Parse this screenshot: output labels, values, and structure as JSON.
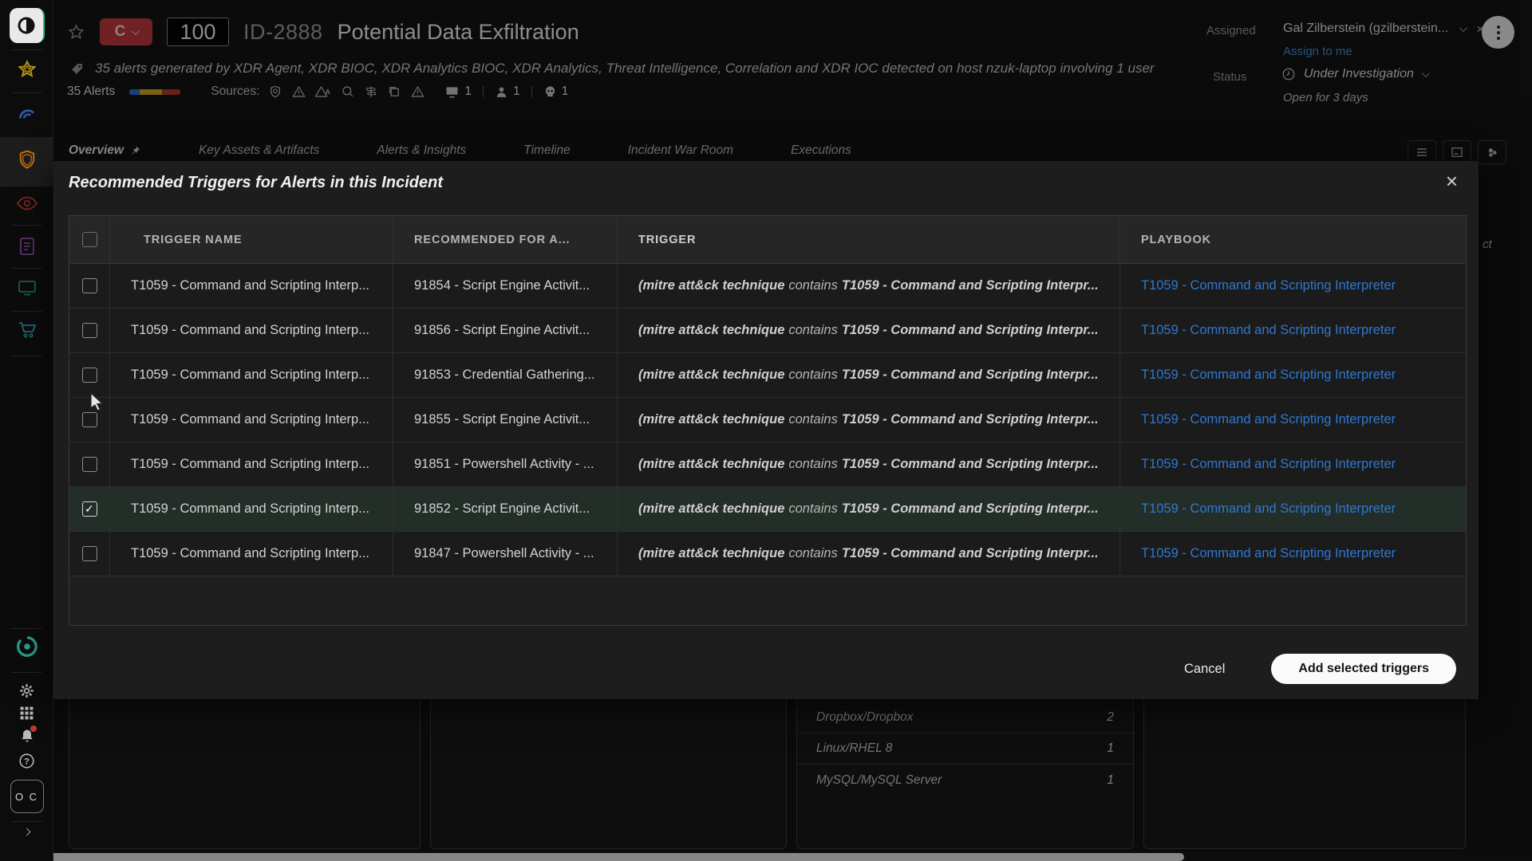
{
  "colors": {
    "severity_red": "#c13a3f",
    "link_blue": "#478fd9",
    "playbook_link": "#2e78d2",
    "selected_row": "#242e28",
    "alert_bar_blue": "#2f6fd6",
    "alert_bar_yellow": "#d1a722",
    "alert_bar_red": "#b03a2e"
  },
  "sidebar": {
    "avatar_initials": "O C",
    "icons_top": [
      "cortex-logo",
      "star",
      "radar",
      "shield-active",
      "eye",
      "report",
      "monitor",
      "cart"
    ],
    "icons_bottom": [
      "ring-logo",
      "gear",
      "apps-grid",
      "bell-notification",
      "help",
      "avatar",
      "expand-chevron"
    ]
  },
  "header": {
    "severity": "C",
    "score": "100",
    "incident_id": "ID-2888",
    "title": "Potential Data Exfiltration",
    "description": "35 alerts generated by XDR Agent, XDR BIOC, XDR Analytics BIOC, XDR Analytics, Threat Intelligence, Correlation and XDR IOC detected on host nzuk-laptop involving 1 user",
    "alerts_count": "35 Alerts",
    "sources_label": "Sources:",
    "source_icons": [
      "shield",
      "alert-triangle",
      "alert-triangle-a",
      "search-glass",
      "signpost",
      "copy",
      "alert-triangle-2"
    ],
    "endpoint_count": "1",
    "user_count": "1",
    "threat_count": "1",
    "assigned_label": "Assigned",
    "assignee": "Gal Zilberstein (gzilberstein...",
    "assign_to_me": "Assign to me",
    "status_label": "Status",
    "status_value": "Under Investigation",
    "open_duration": "Open for 3 days"
  },
  "tabs": [
    {
      "label": "Overview",
      "active": true
    },
    {
      "label": "Key Assets & Artifacts",
      "active": false
    },
    {
      "label": "Alerts & Insights",
      "active": false
    },
    {
      "label": "Timeline",
      "active": false
    },
    {
      "label": "Incident War Room",
      "active": false
    },
    {
      "label": "Executions",
      "active": false
    }
  ],
  "modal": {
    "title": "Recommended Triggers for Alerts in this Incident",
    "columns": [
      "TRIGGER NAME",
      "RECOMMENDED FOR A...",
      "TRIGGER",
      "PLAYBOOK"
    ],
    "rows": [
      {
        "checked": false,
        "trigger_name": "T1059 - Command and Scripting Interp...",
        "recommended_for": "91854 - Script Engine Activit...",
        "trigger_pre": "(mitre att&ck technique",
        "trigger_op": "contains",
        "trigger_val": "T1059 - Command and Scripting Interpr...",
        "playbook": "T1059 - Command and Scripting Interpreter"
      },
      {
        "checked": false,
        "trigger_name": "T1059 - Command and Scripting Interp...",
        "recommended_for": "91856 - Script Engine Activit...",
        "trigger_pre": "(mitre att&ck technique",
        "trigger_op": "contains",
        "trigger_val": "T1059 - Command and Scripting Interpr...",
        "playbook": "T1059 - Command and Scripting Interpreter"
      },
      {
        "checked": false,
        "trigger_name": "T1059 - Command and Scripting Interp...",
        "recommended_for": "91853 - Credential Gathering...",
        "trigger_pre": "(mitre att&ck technique",
        "trigger_op": "contains",
        "trigger_val": "T1059 - Command and Scripting Interpr...",
        "playbook": "T1059 - Command and Scripting Interpreter"
      },
      {
        "checked": false,
        "trigger_name": "T1059 - Command and Scripting Interp...",
        "recommended_for": "91855 - Script Engine Activit...",
        "trigger_pre": "(mitre att&ck technique",
        "trigger_op": "contains",
        "trigger_val": "T1059 - Command and Scripting Interpr...",
        "playbook": "T1059 - Command and Scripting Interpreter"
      },
      {
        "checked": false,
        "trigger_name": "T1059 - Command and Scripting Interp...",
        "recommended_for": "91851 - Powershell Activity - ...",
        "trigger_pre": "(mitre att&ck technique",
        "trigger_op": "contains",
        "trigger_val": "T1059 - Command and Scripting Interpr...",
        "playbook": "T1059 - Command and Scripting Interpreter"
      },
      {
        "checked": true,
        "trigger_name": "T1059 - Command and Scripting Interp...",
        "recommended_for": "91852 - Script Engine Activit...",
        "trigger_pre": "(mitre att&ck technique",
        "trigger_op": "contains",
        "trigger_val": "T1059 - Command and Scripting Interpr...",
        "playbook": "T1059 - Command and Scripting Interpreter"
      },
      {
        "checked": false,
        "trigger_name": "T1059 - Command and Scripting Interp...",
        "recommended_for": "91847 - Powershell Activity - ...",
        "trigger_pre": "(mitre att&ck technique",
        "trigger_op": "contains",
        "trigger_val": "T1059 - Command and Scripting Interpr...",
        "playbook": "T1059 - Command and Scripting Interpreter"
      }
    ],
    "cancel_label": "Cancel",
    "submit_label": "Add selected triggers"
  },
  "background": {
    "asset_list": [
      {
        "label": "Dropbox/Dropbox",
        "count": "2"
      },
      {
        "label": "Linux/RHEL 8",
        "count": "1"
      },
      {
        "label": "MySQL/MySQL Server",
        "count": "1"
      }
    ],
    "text_fragment": "ct"
  }
}
